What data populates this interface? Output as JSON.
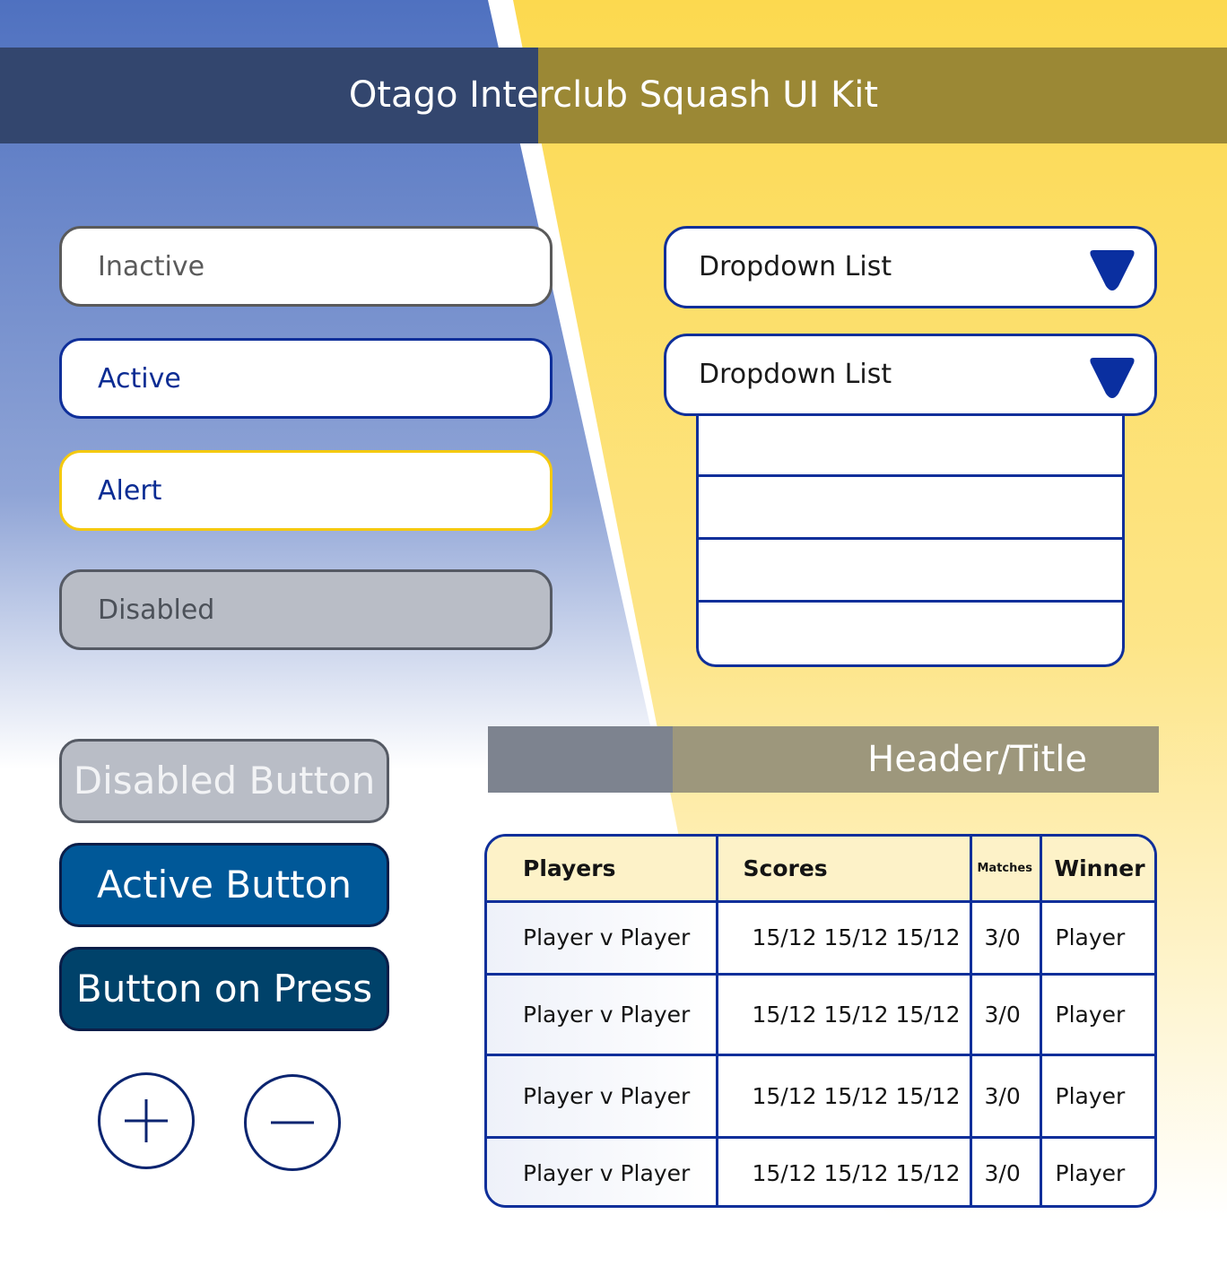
{
  "app": {
    "title": "Otago Interclub Squash UI Kit"
  },
  "colors": {
    "blue_panel": "#4f71c0",
    "yellow_panel": "#fcd94f",
    "accent_blue": "#0f2f9a",
    "alert_yellow": "#f4c90f",
    "active_button": "#005898",
    "pressed_button": "#00426a",
    "disabled_fill": "#b9bdc6"
  },
  "inputs": {
    "inactive": "Inactive",
    "active": "Active",
    "alert": "Alert",
    "disabled": "Disabled"
  },
  "dropdowns": {
    "closed_label": "Dropdown List",
    "open_label": "Dropdown List",
    "arrow_icon": "chevron-down-icon",
    "option_count": 4
  },
  "buttons": {
    "disabled": "Disabled Button",
    "active": "Active Button",
    "pressed": "Button on Press",
    "plus_icon": "plus-icon",
    "minus_icon": "minus-icon"
  },
  "section_header": "Header/Title",
  "table": {
    "columns": [
      "Players",
      "Scores",
      "Matches",
      "Winner"
    ],
    "rows": [
      [
        "Player v Player",
        "15/12 15/12 15/12",
        "3/0",
        "Player"
      ],
      [
        "Player v Player",
        "15/12 15/12 15/12",
        "3/0",
        "Player"
      ],
      [
        "Player v Player",
        "15/12 15/12 15/12",
        "3/0",
        "Player"
      ],
      [
        "Player v Player",
        "15/12 15/12 15/12",
        "3/0",
        "Player"
      ]
    ]
  }
}
